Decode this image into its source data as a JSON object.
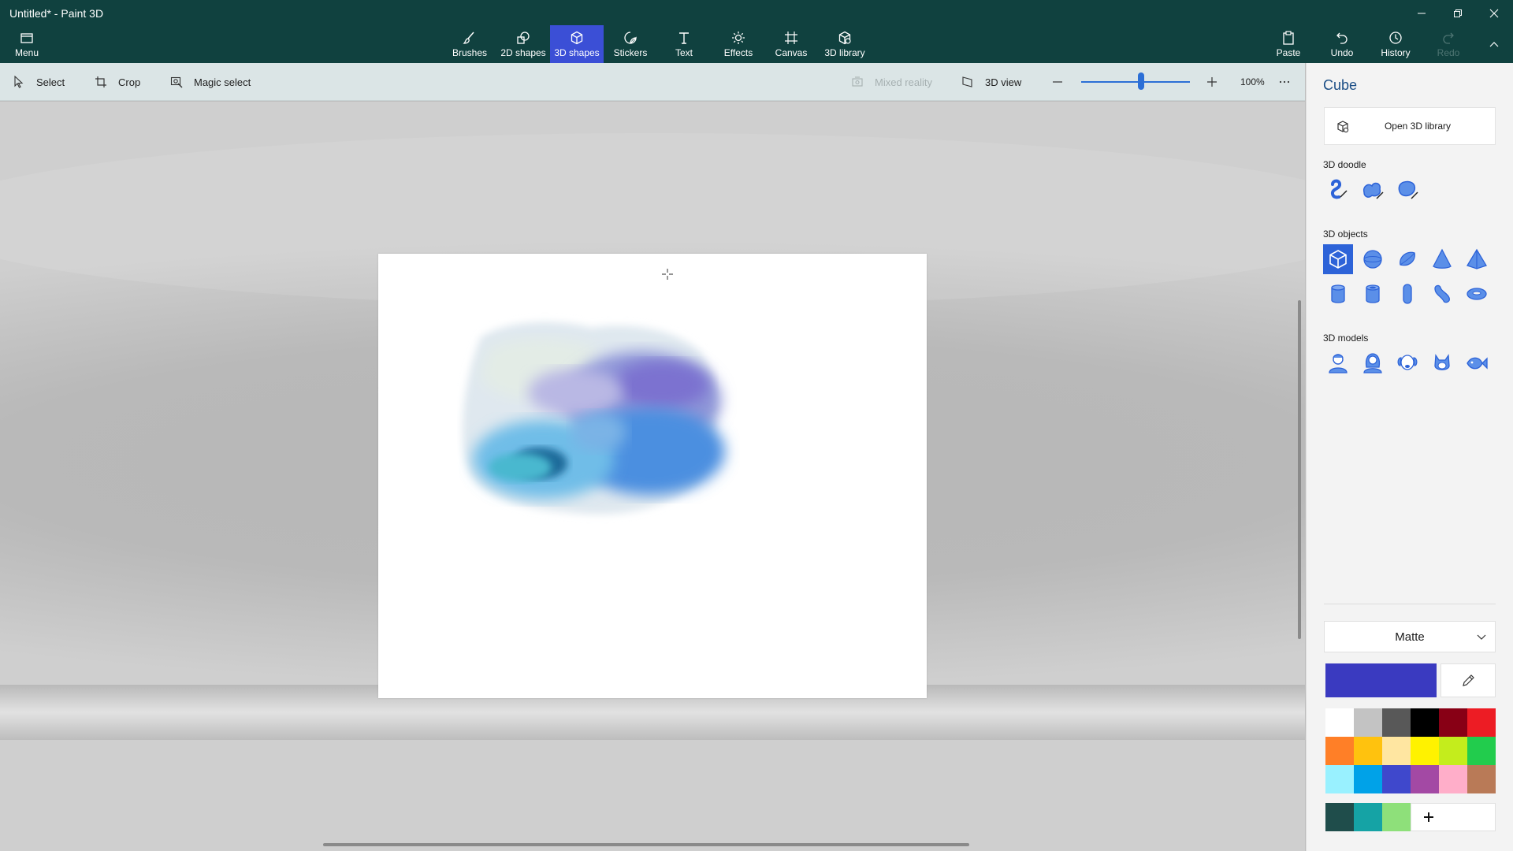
{
  "window": {
    "title": "Untitled* - Paint 3D"
  },
  "ribbon": {
    "menu_label": "Menu",
    "tabs": [
      {
        "label": "Brushes",
        "icon": "brush-icon"
      },
      {
        "label": "2D shapes",
        "icon": "2d-shapes-icon"
      },
      {
        "label": "3D shapes",
        "icon": "3d-shapes-icon",
        "active": true
      },
      {
        "label": "Stickers",
        "icon": "stickers-icon"
      },
      {
        "label": "Text",
        "icon": "text-icon"
      },
      {
        "label": "Effects",
        "icon": "effects-icon"
      },
      {
        "label": "Canvas",
        "icon": "canvas-icon"
      },
      {
        "label": "3D library",
        "icon": "3d-library-icon"
      }
    ],
    "paste_label": "Paste",
    "undo_label": "Undo",
    "history_label": "History",
    "redo_label": "Redo"
  },
  "toolbar": {
    "select_label": "Select",
    "crop_label": "Crop",
    "magic_select_label": "Magic select",
    "mixed_reality_label": "Mixed reality",
    "view_3d_label": "3D view",
    "zoom_label": "100%",
    "zoom_level": 0.55
  },
  "panel": {
    "title": "Cube",
    "open_library_label": "Open 3D library",
    "doodle_title": "3D doodle",
    "doodles": [
      "sharp-edge-doodle-icon",
      "soft-edge-doodle-icon",
      "tube-doodle-icon"
    ],
    "objects_title": "3D objects",
    "objects": [
      "cube-icon",
      "sphere-icon",
      "hemisphere-icon",
      "cone-icon",
      "pyramid-icon",
      "cylinder-icon",
      "tube-icon",
      "capsule-icon",
      "curved-cylinder-icon",
      "donut-icon"
    ],
    "models_title": "3D models",
    "models": [
      "man-model-icon",
      "woman-model-icon",
      "dog-model-icon",
      "cat-model-icon",
      "fish-model-icon"
    ],
    "material_label": "Matte"
  },
  "colors": {
    "selected": "#3a3ac0",
    "palette": [
      "#ffffff",
      "#c3c3c3",
      "#585858",
      "#000000",
      "#880015",
      "#ed1c24",
      "#ff7f27",
      "#ffc20e",
      "#ffe6a1",
      "#fff200",
      "#c4ed1c",
      "#22cc4d",
      "#99f1ff",
      "#00a2e8",
      "#3f48cc",
      "#a349a4",
      "#ffaec9",
      "#b97a57"
    ],
    "custom": [
      "#1f4d4b",
      "#15a3a5",
      "#8ee07a"
    ],
    "accent": "#3b4fd6",
    "titlebar": "#10413f"
  }
}
